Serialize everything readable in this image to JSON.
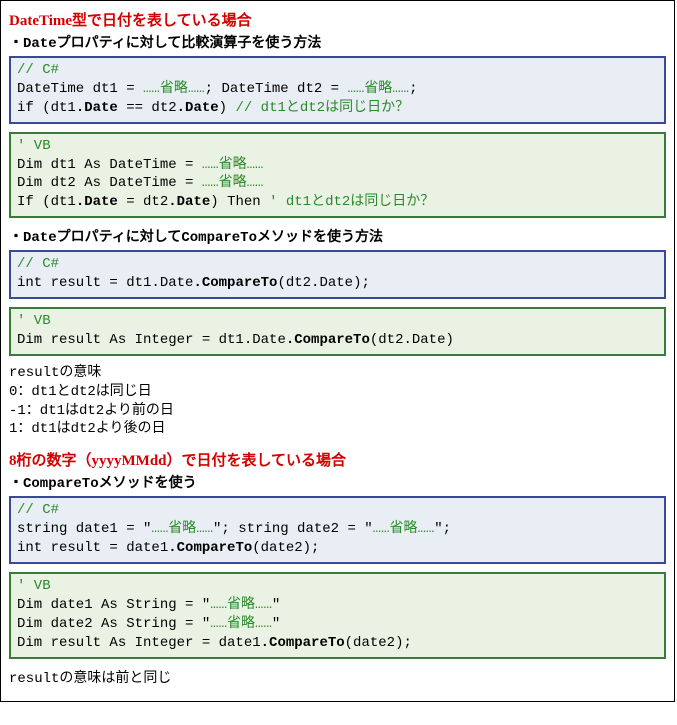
{
  "section1": {
    "title": "DateTime型で日付を表している場合",
    "sub1_pre": "・",
    "sub1_mono1": "Date",
    "sub1_mid": "プロパティに対して比較演算子を使う方法",
    "cs1_c": "// C#",
    "cs1_l1a": "DateTime dt1 = ",
    "cs1_l1b": "……省略……",
    "cs1_l1c": "; DateTime dt2 = ",
    "cs1_l1d": "……省略……",
    "cs1_l1e": ";",
    "cs1_l2a": "if (dt1",
    "cs1_l2b": ".Date",
    "cs1_l2c": " == dt2",
    "cs1_l2d": ".Date",
    "cs1_l2e": ") ",
    "cs1_l2f": "// dt1とdt2は同じ日か？",
    "vb1_c": "' VB",
    "vb1_l1a": "Dim dt1 As DateTime = ",
    "vb1_l1b": "……省略……",
    "vb1_l2a": "Dim dt2 As DateTime = ",
    "vb1_l2b": "……省略……",
    "vb1_l3a": "If (dt1",
    "vb1_l3b": ".Date",
    "vb1_l3c": " = dt2",
    "vb1_l3d": ".Date",
    "vb1_l3e": ") Then ",
    "vb1_l3f": "' dt1とdt2は同じ日か？",
    "sub2_pre": "・",
    "sub2_mono1": "Date",
    "sub2_mid": "プロパティに対して",
    "sub2_mono2": "CompareTo",
    "sub2_end": "メソッドを使う方法",
    "cs2_c": "// C#",
    "cs2_l1a": "int result = dt1.Date",
    "cs2_l1b": ".CompareTo",
    "cs2_l1c": "(dt2.Date);",
    "vb2_c": "' VB",
    "vb2_l1a": "Dim result As Integer = dt1.Date",
    "vb2_l1b": ".CompareTo",
    "vb2_l1c": "(dt2.Date)",
    "result_title": "resultの意味",
    "result_0": "0：dt1とdt2は同じ日",
    "result_m1": "-1：dt1はdt2より前の日",
    "result_1": "1：dt1はdt2より後の日"
  },
  "section2": {
    "title": "8桁の数字（yyyyMMdd）で日付を表している場合",
    "sub_pre": "・",
    "sub_mono": "CompareTo",
    "sub_end": "メソッドを使う",
    "cs_c": "// C#",
    "cs_l1a": "string date1 = \"",
    "cs_l1b": "……省略……",
    "cs_l1c": "\"; string date2 = \"",
    "cs_l1d": "……省略……",
    "cs_l1e": "\";",
    "cs_l2a": "int result = date1",
    "cs_l2b": ".CompareTo",
    "cs_l2c": "(date2);",
    "vb_c": "' VB",
    "vb_l1a": "Dim date1 As String = \"",
    "vb_l1b": "……省略……",
    "vb_l1c": "\"",
    "vb_l2a": "Dim date2 As String = \"",
    "vb_l2b": "……省略……",
    "vb_l2c": "\"",
    "vb_l3a": "Dim result As Integer = date1",
    "vb_l3b": ".CompareTo",
    "vb_l3c": "(date2);",
    "footer": "resultの意味は前と同じ"
  }
}
